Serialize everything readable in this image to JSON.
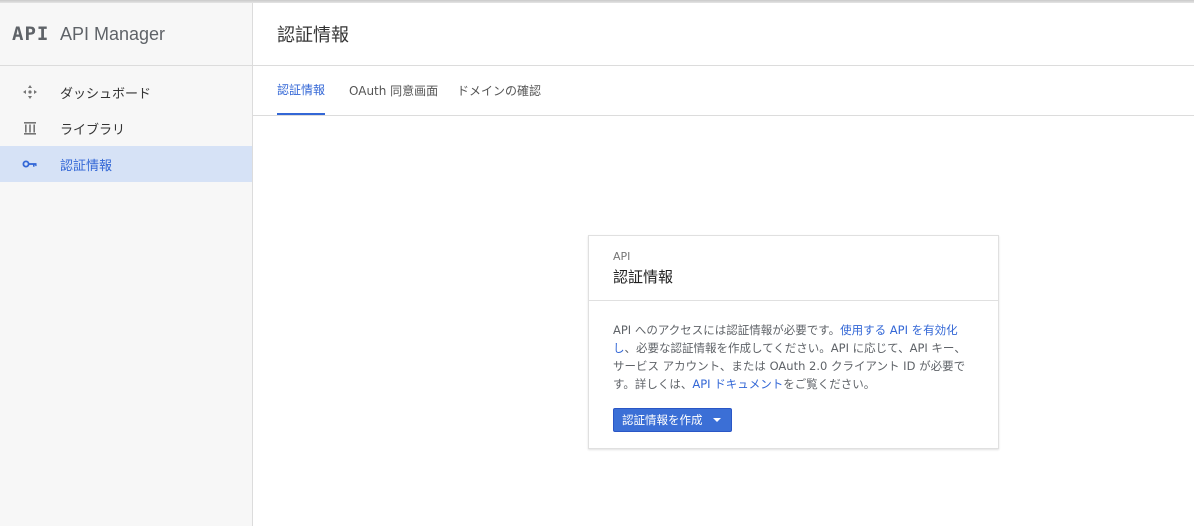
{
  "app": {
    "logo": "API",
    "title": "API Manager"
  },
  "sidebar": {
    "items": [
      {
        "label": "ダッシュボード",
        "icon": "dashboard-icon",
        "active": false
      },
      {
        "label": "ライブラリ",
        "icon": "library-icon",
        "active": false
      },
      {
        "label": "認証情報",
        "icon": "key-icon",
        "active": true
      }
    ]
  },
  "header": {
    "title": "認証情報"
  },
  "tabs": [
    {
      "label": "認証情報",
      "active": true
    },
    {
      "label": "OAuth 同意画面",
      "active": false
    },
    {
      "label": "ドメインの確認",
      "active": false
    }
  ],
  "card": {
    "kicker": "API",
    "title": "認証情報",
    "body": {
      "text1": "API へのアクセスには認証情報が必要です。",
      "link1": "使用する API を有効化し",
      "text2": "、必要な認証情報を作成してください。API に応じて、API キー、サービス アカウント、または OAuth 2.0 クライアント ID が必要です。詳しくは、",
      "link2": "API ドキュメント",
      "text3": "をご覧ください。"
    },
    "button_label": "認証情報を作成"
  },
  "colors": {
    "accent": "#3367d6",
    "active_nav_bg": "#d6e2f6",
    "button_bg": "#3b6fd6"
  }
}
